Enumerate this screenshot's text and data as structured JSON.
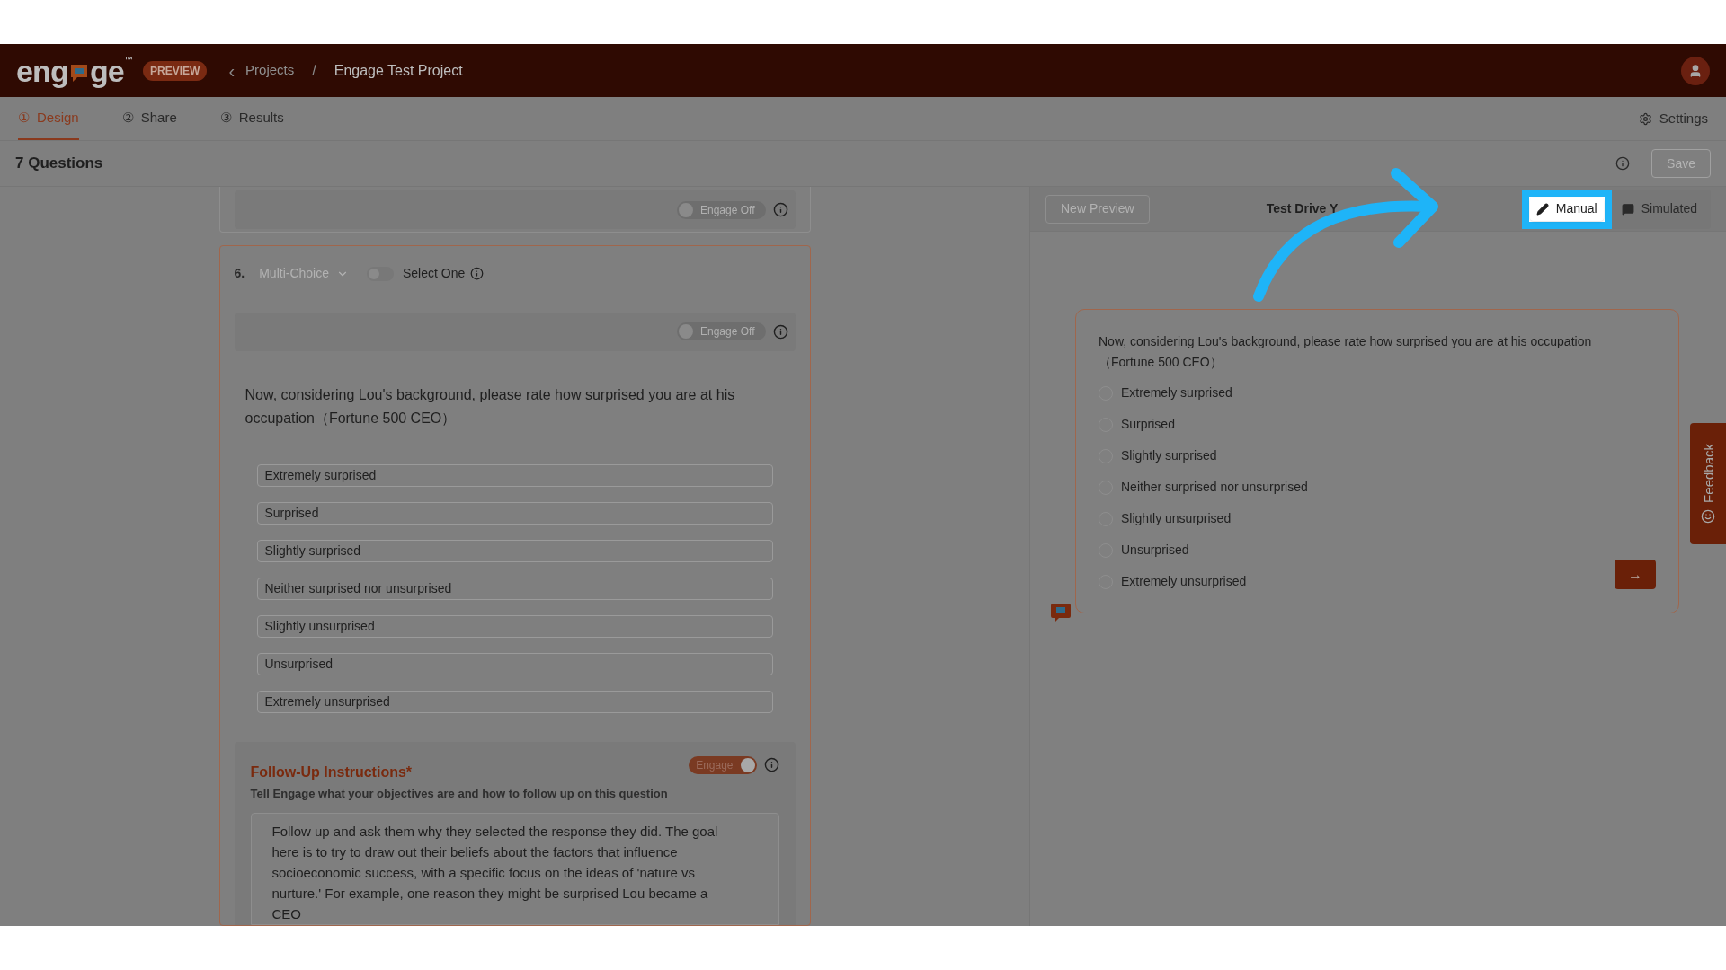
{
  "header": {
    "logo_start": "eng",
    "logo_end": "ge",
    "logo_mark": "™",
    "badge": "PREVIEW",
    "back": "‹",
    "separator": "/",
    "breadcrumb": [
      {
        "label": "Projects"
      },
      {
        "label": "Engage Test Project"
      }
    ]
  },
  "tabs": [
    {
      "icon": "①",
      "label": "Design",
      "selected": true
    },
    {
      "icon": "②",
      "label": "Share",
      "selected": false
    },
    {
      "icon": "③",
      "label": "Results",
      "selected": false
    }
  ],
  "settings": "Settings",
  "toolbar": {
    "title": "7 Questions",
    "save": "Save",
    "save_disabled": true
  },
  "previous_card": {
    "engage_toggle": {
      "label": "Engage Off",
      "on": false
    }
  },
  "question": {
    "number": "6.",
    "type": "Multi-Choice",
    "select_one": {
      "label": "Select One",
      "on": false
    },
    "engage_toggle": {
      "label": "Engage Off",
      "on": false
    },
    "text": "Now, considering Lou's background, please rate how surprised you are at his occupation（Fortune 500 CEO）",
    "options": [
      "Extremely surprised",
      "Surprised",
      "Slightly surprised",
      "Neither surprised nor unsurprised",
      "Slightly unsurprised",
      "Unsurprised",
      "Extremely unsurprised"
    ],
    "follow_up": {
      "title": "Follow-Up Instructions*",
      "toggle": {
        "label": "Engage",
        "on": true
      },
      "description": "Tell Engage what your objectives are and how to follow up on this question",
      "instructions": "Follow up and ask them why they selected the response they did. The goal here is to try to draw out their beliefs about the factors that influence socioeconomic success, with a specific focus on the ideas of 'nature vs nurture.' For example, one reason they might be surprised Lou became a CEO"
    }
  },
  "preview": {
    "new_preview": "New Preview",
    "title": "Test Drive Y",
    "modes": [
      {
        "label": "Manual",
        "selected": true
      },
      {
        "label": "Simulated",
        "selected": false
      }
    ],
    "question": "Now, considering Lou's background, please rate how surprised you are at his occupation（Fortune 500 CEO）",
    "options": [
      {
        "label": "Extremely surprised",
        "selected": false
      },
      {
        "label": "Surprised",
        "selected": false
      },
      {
        "label": "Slightly surprised",
        "selected": false
      },
      {
        "label": "Neither surprised nor unsurprised",
        "selected": false
      },
      {
        "label": "Slightly unsurprised",
        "selected": false
      },
      {
        "label": "Unsurprised",
        "selected": false
      },
      {
        "label": "Extremely unsurprised",
        "selected": false
      }
    ],
    "next": "→"
  },
  "feedback": "Feedback"
}
